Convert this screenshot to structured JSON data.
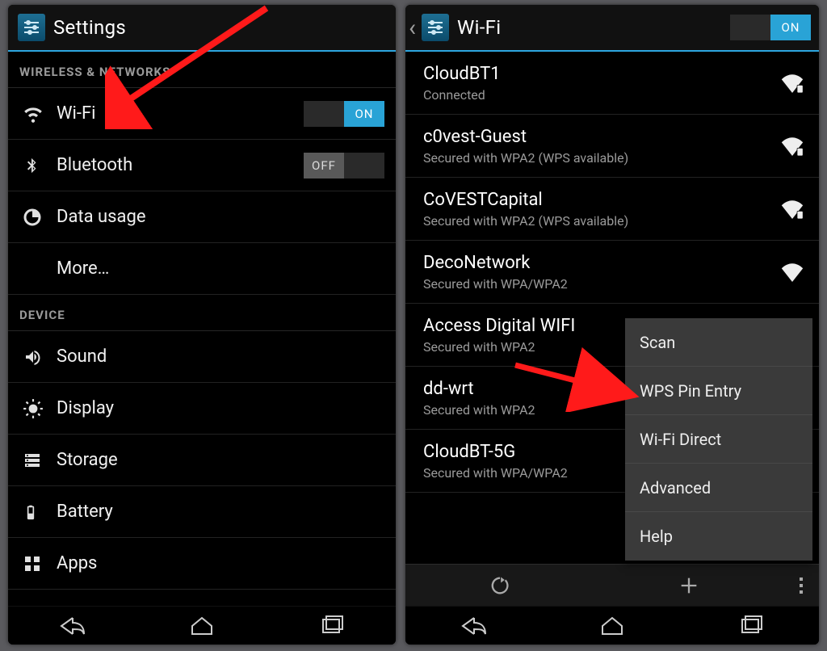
{
  "left": {
    "title": "Settings",
    "sections": [
      {
        "header": "WIRELESS & NETWORKS",
        "items": [
          {
            "label": "Wi-Fi",
            "icon": "wifi-icon",
            "toggle": "ON"
          },
          {
            "label": "Bluetooth",
            "icon": "bluetooth-icon",
            "toggle": "OFF"
          },
          {
            "label": "Data usage",
            "icon": "data-icon"
          },
          {
            "label": "More…"
          }
        ]
      },
      {
        "header": "DEVICE",
        "items": [
          {
            "label": "Sound",
            "icon": "sound-icon"
          },
          {
            "label": "Display",
            "icon": "display-icon"
          },
          {
            "label": "Storage",
            "icon": "storage-icon"
          },
          {
            "label": "Battery",
            "icon": "battery-icon"
          },
          {
            "label": "Apps",
            "icon": "apps-icon"
          }
        ]
      }
    ]
  },
  "right": {
    "title": "Wi-Fi",
    "toggle": "ON",
    "networks": [
      {
        "name": "CloudBT1",
        "sub": "Connected",
        "secure": true
      },
      {
        "name": "c0vest-Guest",
        "sub": "Secured with WPA2 (WPS available)",
        "secure": true
      },
      {
        "name": "CoVESTCapital",
        "sub": "Secured with WPA2 (WPS available)",
        "secure": true
      },
      {
        "name": "DecoNetwork",
        "sub": "Secured with WPA/WPA2",
        "secure": true
      },
      {
        "name": "Access Digital WIFI",
        "sub": "Secured with WPA2",
        "secure": true
      },
      {
        "name": "dd-wrt",
        "sub": "Secured with WPA2",
        "secure": true
      },
      {
        "name": "CloudBT-5G",
        "sub": "Secured with WPA/WPA2",
        "secure": true
      }
    ],
    "popup": [
      "Scan",
      "WPS Pin Entry",
      "Wi-Fi Direct",
      "Advanced",
      "Help"
    ]
  },
  "colors": {
    "accent": "#29a3d6"
  }
}
